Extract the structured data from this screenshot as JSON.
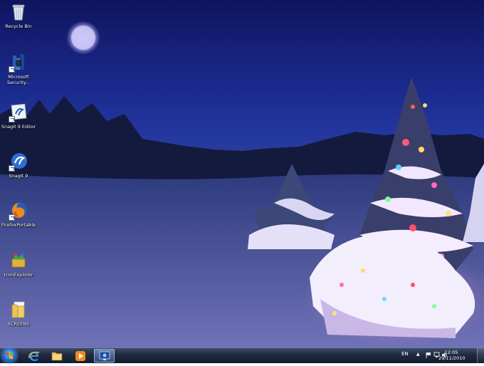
{
  "desktop": {
    "icons": [
      {
        "label": "Recycle Bin",
        "icon": "recycle-bin-icon"
      },
      {
        "label": "Microsoft Security...",
        "icon": "microsoft-security-icon"
      },
      {
        "label": "SnagIt 9 Editor",
        "icon": "snagit-editor-icon"
      },
      {
        "label": "SnagIt 9",
        "icon": "snagit-icon"
      },
      {
        "label": "FirefoxPortable",
        "icon": "firefox-icon"
      },
      {
        "label": "IconExplorer",
        "icon": "iconexplorer-icon"
      },
      {
        "label": "SCREENS",
        "icon": "folder-icon"
      }
    ]
  },
  "taskbar": {
    "pinned": [
      {
        "icon": "internet-explorer-icon"
      },
      {
        "icon": "windows-explorer-icon"
      },
      {
        "icon": "media-player-icon"
      },
      {
        "icon": "remote-desktop-icon",
        "active": true
      }
    ],
    "tray": {
      "language": "EN",
      "time": "12:05",
      "date": "29/11/2010"
    }
  },
  "colors": {
    "sky_top": "#10145e",
    "snow": "#6a6fb2",
    "taskbar": "#1f2a40"
  }
}
